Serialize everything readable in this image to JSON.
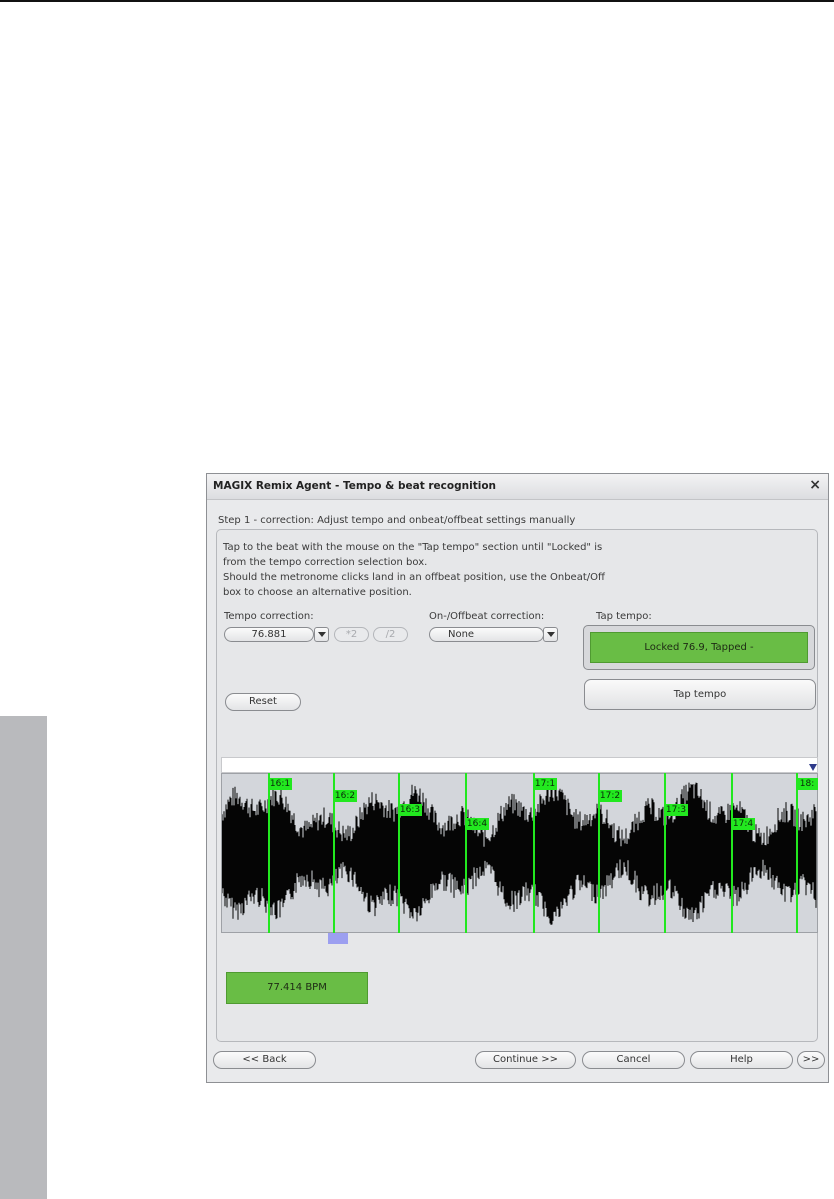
{
  "dialog": {
    "title": "MAGIX Remix Agent - Tempo & beat recognition",
    "close_glyph": "×",
    "step_title": "Step 1 - correction: Adjust tempo and onbeat/offbeat settings manually",
    "instructions": [
      "Tap to the beat with the mouse on the \"Tap tempo\" section until \"Locked\" is",
      "from the tempo correction selection box.",
      "Should the metronome clicks land in an offbeat position, use the Onbeat/Off",
      "box to choose an alternative position."
    ]
  },
  "tempo_correction": {
    "label": "Tempo correction:",
    "value": "76.881",
    "double_label": "*2",
    "half_label": "/2"
  },
  "offbeat_correction": {
    "label": "On-/Offbeat correction:",
    "value": "None"
  },
  "tap_tempo": {
    "label": "Tap tempo:",
    "display": "Locked 76.9, Tapped -",
    "button_label": "Tap tempo"
  },
  "reset_label": "Reset",
  "waveform": {
    "beat_markers": [
      "16:1",
      "16:2",
      "16:3",
      "16:4",
      "17:1",
      "17:2",
      "17:3",
      "17:4",
      "18:"
    ]
  },
  "bpm_display": "77.414 BPM",
  "buttons": {
    "back": "<< Back",
    "continue": "Continue >>",
    "cancel": "Cancel",
    "help": "Help",
    "more": ">>"
  },
  "colors": {
    "accent_green": "#69bd45",
    "marker_green": "#22e81f",
    "playhead": "#9c9ff0"
  }
}
